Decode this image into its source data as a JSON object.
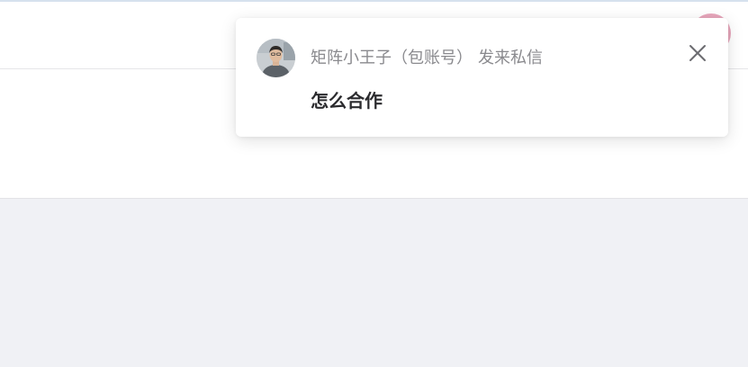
{
  "notification": {
    "sender_name": "矩阵小王子（包账号）",
    "action_text": "发来私信",
    "message": "怎么合作",
    "avatar_icon": "user-avatar",
    "close_icon": "close-icon"
  },
  "colors": {
    "header_avatar": "#e7a6bb",
    "page_background": "#f0f1f5",
    "panel_background": "#ffffff",
    "sender_text": "#8a8a8e",
    "message_text": "#2b2b2e"
  }
}
